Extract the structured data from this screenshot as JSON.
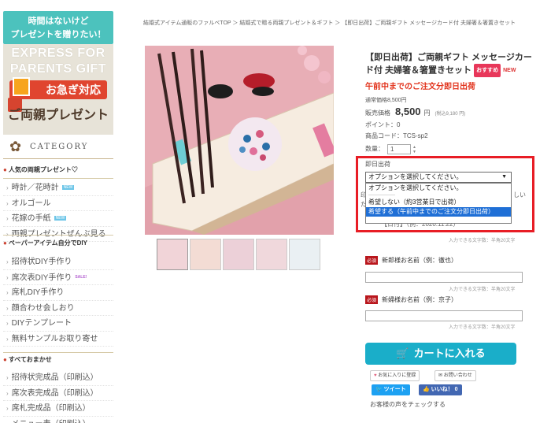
{
  "sidebar": {
    "banner_line1": "時間はないけど",
    "banner_line2": "プレゼントを贈りたい！",
    "express_line1": "EXPRESS FOR",
    "express_line2": "PARENTS GIFT",
    "hurry": "お急ぎ対応",
    "parents_present": "ご両親プレゼント",
    "category": "CATEGORY",
    "section_popular": "人気の両親プレゼント♡",
    "popular_items": [
      {
        "label": "時計／花時計",
        "tag": "NEW"
      },
      {
        "label": "オルゴール",
        "tag": ""
      },
      {
        "label": "花嫁の手紙",
        "tag": "NEW"
      },
      {
        "label": "両親プレゼントぜんぶ見る",
        "tag": ""
      }
    ],
    "section_paper": "ペーパーアイテム自分でDIY",
    "paper_items": [
      {
        "label": "招待状DIY手作り",
        "tag": ""
      },
      {
        "label": "席次表DIY手作り",
        "tag": "SALE!"
      },
      {
        "label": "席札DIY手作り",
        "tag": ""
      },
      {
        "label": "顔合わせ会しおり",
        "tag": ""
      },
      {
        "label": "DIYテンプレート",
        "tag": ""
      },
      {
        "label": "無料サンプルお取り寄せ",
        "tag": ""
      }
    ],
    "section_all": "すべておまかせ",
    "all_items": [
      {
        "label": "招待状完成品（印刷込）"
      },
      {
        "label": "席次表完成品（印刷込）"
      },
      {
        "label": "席札完成品（印刷込）"
      },
      {
        "label": "メニュー表（印刷込）"
      }
    ]
  },
  "breadcrumb": "結婚式アイテム通販のファルベTOP ＞ 結婚式で贈る両親プレゼント＆ギフト ＞ 【即日出荷】ご両親ギフト メッセージカード付 夫婦箸＆箸置きセット",
  "product": {
    "title": "【即日出荷】ご両親ギフト メッセージカード付 夫婦箸＆箸置きセット",
    "badge_recommend": "おすすめ",
    "badge_new": "NEW",
    "catch": "午前中までのご注文分即日出荷",
    "list_price": "通常価格8,500円",
    "price_label": "販売価格",
    "price": "8,500",
    "price_unit": "円",
    "price_tax": "(税込9,180 円)",
    "points": "ポイント：0",
    "code": "商品コード：TCS-sp2",
    "qty_label": "数量：",
    "qty_value": "1"
  },
  "option": {
    "label": "即日出荷",
    "selected": "オプションを選択してください。",
    "options": [
      "オプションを選択してください。",
      "-----------------",
      "希望しない（約3営業日で出荷）",
      "希望する（午前中までのご注文分即日出荷）"
    ],
    "highlighted_index": 3
  },
  "behind": {
    "left1": "印",
    "left2": "た",
    "right1": "しい",
    "partial": "【日付】（例：2020.11.22）"
  },
  "form": {
    "req": "必須",
    "field1_label": "新郎様お名前（例：徹也）",
    "field2_label": "新婦様お名前（例：京子）",
    "count_text": "入力できる文字数：半角20文字"
  },
  "actions": {
    "cart": "カートに入れる",
    "favorite": "お気に入りに登録",
    "inquiry": "お問い合わせ",
    "tweet": "ツイート",
    "like": "いいね！ 0",
    "voice": "お客様の声をチェックする"
  },
  "colors": {
    "accent_red": "#e81d25",
    "cart_teal": "#1aaec9",
    "banner_teal": "#4cc2bd",
    "hurry_red": "#e0452f",
    "photo_pink": "#e8aeb6"
  }
}
